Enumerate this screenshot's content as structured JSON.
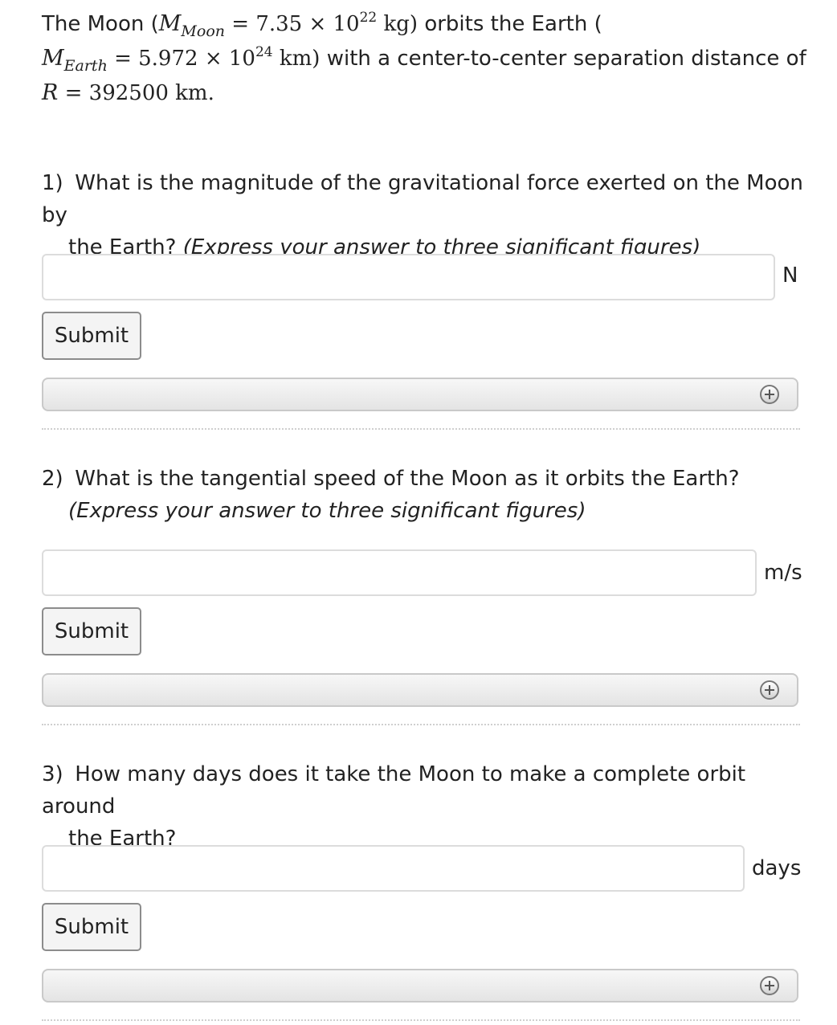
{
  "intro": {
    "t1": "The Moon (",
    "m_moon_sym": "M",
    "m_moon_sub": "Moon",
    "m_moon_eq": " = 7.35 × 10",
    "m_moon_exp": "22",
    "m_moon_unit": " kg)",
    "t2": " orbits the Earth (",
    "m_earth_sym": "M",
    "m_earth_sub": "Earth",
    "m_earth_eq": " = 5.972 × 10",
    "m_earth_exp": "24",
    "m_earth_unit": " km)",
    "t3": " with a center-to-center separation distance of",
    "r_sym": "R",
    "r_eq": " = 392500 km."
  },
  "questions": [
    {
      "number": "1)",
      "text": "What is the magnitude of the gravitational force exerted on the Moon by",
      "text2": "the Earth?",
      "note": "(Express your answer to three significant figures)",
      "unit": "N",
      "input_value": "",
      "submit_label": "Submit"
    },
    {
      "number": "2)",
      "text": "What is the tangential speed of the Moon as it orbits the Earth?",
      "note": "(Express your answer to three significant figures)",
      "unit": "m/s",
      "input_value": "",
      "submit_label": "Submit"
    },
    {
      "number": "3)",
      "text": "How many days does it take the Moon to make a complete orbit around",
      "text2": "the Earth?",
      "unit": "days",
      "input_value": "",
      "submit_label": "Submit"
    }
  ],
  "icons": {
    "hint_toggle": "plus-circle-icon"
  }
}
